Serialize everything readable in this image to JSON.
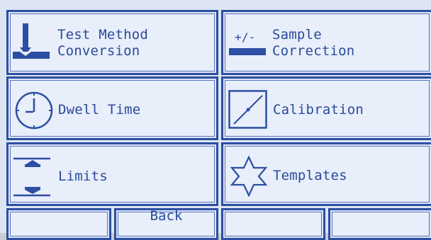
{
  "menu": {
    "test_method": {
      "line1": "Test Method",
      "line2": "Conversion",
      "icon": "indenter-icon"
    },
    "sample_correction": {
      "line1": "Sample",
      "line2": "Correction",
      "prefix": "+/-",
      "icon": "plus-minus-bar-icon"
    },
    "dwell_time": {
      "label": "Dwell Time",
      "icon": "clock-icon"
    },
    "calibration": {
      "label": "Calibration",
      "icon": "diagonal-line-icon"
    },
    "limits": {
      "label": "Limits",
      "icon": "limits-arrows-icon"
    },
    "templates": {
      "label": "Templates",
      "icon": "star-icon"
    }
  },
  "nav": {
    "back_label": "Back"
  },
  "colors": {
    "accent": "#2c4fa3",
    "text": "#2a4b9a",
    "button_bg": "#e8eefa",
    "screen_bg": "#dde5f3"
  }
}
